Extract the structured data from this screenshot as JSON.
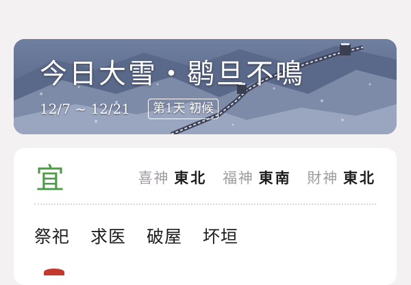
{
  "banner": {
    "title": "今日大雪・鹖旦不鳴",
    "date_range": "12/7 ~ 12/21",
    "badge": "第1天 初候"
  },
  "almanac": {
    "yi_char": "宜",
    "deities": [
      {
        "label": "喜神",
        "direction": "東北"
      },
      {
        "label": "福神",
        "direction": "東南"
      },
      {
        "label": "財神",
        "direction": "東北"
      }
    ],
    "activities": [
      "祭祀",
      "求医",
      "破屋",
      "坏垣"
    ]
  },
  "colors": {
    "yi_green": "#4f9a4a",
    "deity_label_gray": "#9f9aa0",
    "ji_red": "#c23a2e"
  }
}
